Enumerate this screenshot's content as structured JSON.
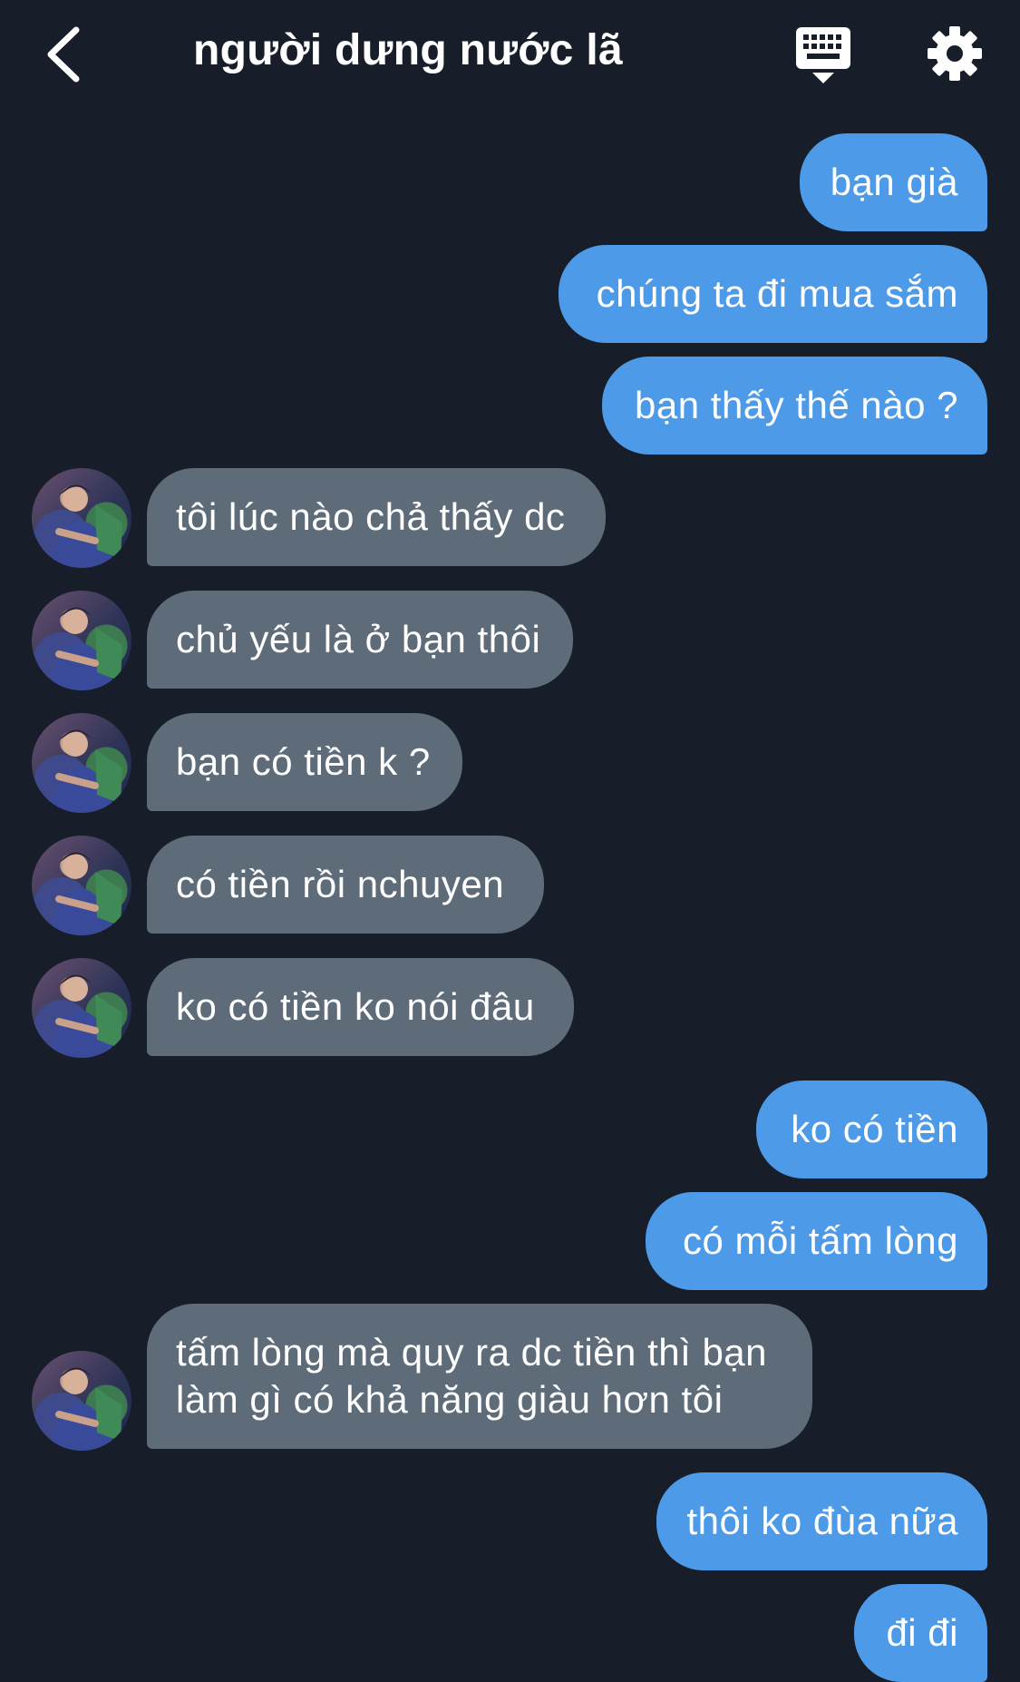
{
  "header": {
    "title": "người dưng nước lã",
    "back_icon": "chevron-left-icon",
    "keyboard_icon": "keyboard-icon",
    "settings_icon": "gear-icon"
  },
  "colors": {
    "background": "#171e29",
    "sent_bubble": "#4d9be8",
    "received_bubble": "#5e6c7a"
  },
  "messages": [
    {
      "side": "sent",
      "text": "bạn già"
    },
    {
      "side": "sent",
      "text": "chúng ta đi mua sắm"
    },
    {
      "side": "sent",
      "text": "bạn thấy thế nào ?"
    },
    {
      "side": "received",
      "text": "tôi lúc nào chả thấy dc"
    },
    {
      "side": "received",
      "text": "chủ yếu là ở bạn thôi"
    },
    {
      "side": "received",
      "text": "bạn có tiền k ?"
    },
    {
      "side": "received",
      "text": "có tiền rồi nchuyen"
    },
    {
      "side": "received",
      "text": "ko có tiền ko nói đâu"
    },
    {
      "side": "sent",
      "text": "ko có tiền"
    },
    {
      "side": "sent",
      "text": "có mỗi tấm lòng"
    },
    {
      "side": "received",
      "text": "tấm lòng mà quy ra dc tiền thì bạn\nlàm gì có khả năng giàu hơn tôi"
    },
    {
      "side": "sent",
      "text": "thôi ko đùa nữa"
    },
    {
      "side": "sent",
      "text": "đi đi"
    }
  ]
}
